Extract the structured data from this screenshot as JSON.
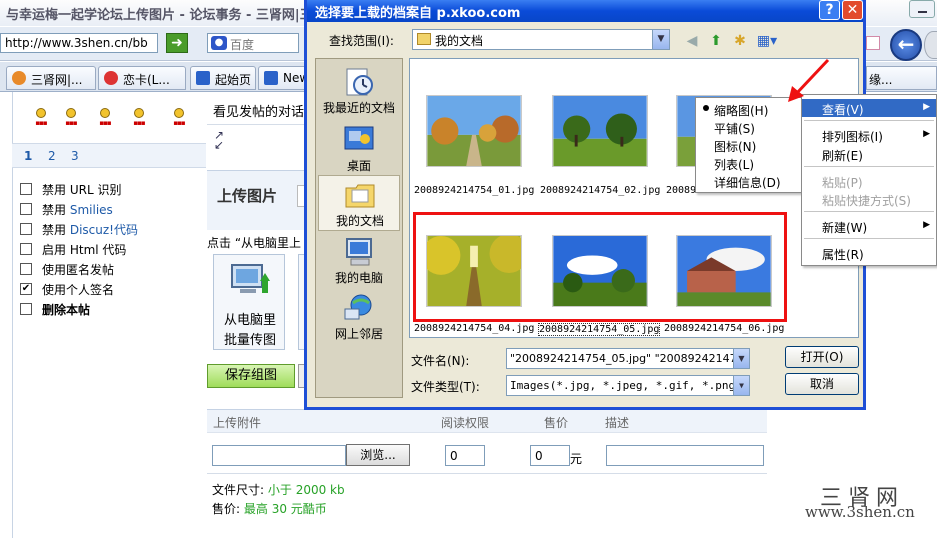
{
  "browser": {
    "title": "与幸运梅一起学论坛上传图片 - 论坛事务 - 三肾网|三",
    "address": "http://www.3shen.cn/bb",
    "search_placeholder": "百度",
    "tabs": [
      "三肾网|...",
      "恋卡(L...",
      "起始页",
      "New"
    ],
    "tab_right": "缘..."
  },
  "left_panel": {
    "smilies": [
      "smile",
      "laugh",
      "cool",
      "wink",
      "cry"
    ],
    "pages": [
      "1",
      "2",
      "3"
    ],
    "options": [
      {
        "checked": false,
        "prefix": "禁用",
        "label": "URL 识别",
        "blue": false
      },
      {
        "checked": false,
        "prefix": "禁用",
        "label": "Smilies",
        "blue": true
      },
      {
        "checked": false,
        "prefix": "禁用",
        "label": "Discuz!代码",
        "blue": true
      },
      {
        "checked": false,
        "prefix": "启用",
        "label": "Html 代码",
        "blue": false
      },
      {
        "checked": false,
        "prefix": "",
        "label": "使用匿名发帖",
        "blue": false
      },
      {
        "checked": true,
        "prefix": "",
        "label": "使用个人签名",
        "blue": false
      },
      {
        "checked": false,
        "prefix": "",
        "label": "删除本帖",
        "blue": false
      }
    ]
  },
  "main": {
    "reply_hint": "看见发帖的对话",
    "upload_title": "上传图片",
    "upload_hint": "点击 “从电脑里上",
    "batch_label_1": "从电脑里",
    "batch_label_2": "批量传图",
    "save_group": "保存组图",
    "attach": {
      "col_upload": "上传附件",
      "col_perm": "阅读权限",
      "col_price": "售价",
      "col_desc": "描述",
      "browse": "浏览...",
      "perm_value": "0",
      "price_value": "0",
      "yuan": "元",
      "size_label": "文件尺寸:",
      "size_value": "小于 2000 kb",
      "price_label": "售价:",
      "price_max": "最高 30 元酷币"
    }
  },
  "watermark": {
    "line1": "三肾网",
    "line2": "www.3shen.cn"
  },
  "dialog": {
    "title": "选择要上载的档案自 p.xkoo.com",
    "help": "?",
    "close": "✕",
    "lookin_label": "查找范围(I):",
    "lookin_value": "我的文档",
    "places": [
      "我最近的文档",
      "桌面",
      "我的文档",
      "我的电脑",
      "网上邻居"
    ],
    "files": [
      "2008924214754_01.jpg",
      "2008924214754_02.jpg",
      "20089",
      "2008924214754_04.jpg",
      "2008924214754_05.jpg",
      "2008924214754_06.jpg"
    ],
    "filename_label": "文件名(N):",
    "filename_value": "\"2008924214754_05.jpg\" \"2008924214754_",
    "filetype_label": "文件类型(T):",
    "filetype_value": "Images(*.jpg, *.jpeg, *.gif, *.png,*.",
    "open_btn": "打开(O)",
    "cancel_btn": "取消"
  },
  "view_submenu": [
    "缩略图(H)",
    "平铺(S)",
    "图标(N)",
    "列表(L)",
    "详细信息(D)"
  ],
  "context_menu": {
    "view": "查看(V)",
    "arrange": "排列图标(I)",
    "refresh": "刷新(E)",
    "paste": "粘贴(P)",
    "paste_shortcut": "粘贴快捷方式(S)",
    "new": "新建(W)",
    "properties": "属性(R)"
  },
  "colors": {
    "dialog_blue": "#1e4fd6",
    "highlight": "#316ac5",
    "annotation_red": "#e11111",
    "green_text": "#27a227"
  }
}
